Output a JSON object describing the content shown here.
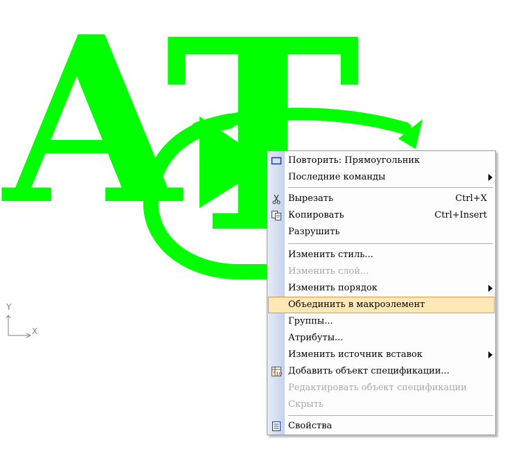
{
  "canvas": {
    "letter_a": "A",
    "letter_t": "T",
    "axis_y_label": "Y",
    "axis_x_label": "X",
    "drawing_color": "#00ff00"
  },
  "context_menu": {
    "items": [
      {
        "label": "Повторить: Прямоугольник",
        "shortcut": "",
        "submenu": false,
        "disabled": false,
        "icon": "rectangle-icon"
      },
      {
        "label": "Последние команды",
        "shortcut": "",
        "submenu": true,
        "disabled": false,
        "icon": ""
      },
      {
        "label": "Вырезать",
        "shortcut": "Ctrl+X",
        "submenu": false,
        "disabled": false,
        "icon": "scissors-icon"
      },
      {
        "label": "Копировать",
        "shortcut": "Ctrl+Insert",
        "submenu": false,
        "disabled": false,
        "icon": "copy-icon"
      },
      {
        "label": "Разрушить",
        "shortcut": "",
        "submenu": false,
        "disabled": false,
        "icon": ""
      },
      {
        "label": "Изменить стиль...",
        "shortcut": "",
        "submenu": false,
        "disabled": false,
        "icon": ""
      },
      {
        "label": "Изменить слой...",
        "shortcut": "",
        "submenu": false,
        "disabled": true,
        "icon": ""
      },
      {
        "label": "Изменить порядок",
        "shortcut": "",
        "submenu": true,
        "disabled": false,
        "icon": ""
      },
      {
        "label": "Объединить в макроэлемент",
        "shortcut": "",
        "submenu": false,
        "disabled": false,
        "highlighted": true,
        "icon": ""
      },
      {
        "label": "Группы...",
        "shortcut": "",
        "submenu": false,
        "disabled": false,
        "icon": ""
      },
      {
        "label": "Атрибуты...",
        "shortcut": "",
        "submenu": false,
        "disabled": false,
        "icon": ""
      },
      {
        "label": "Изменить источник вставок",
        "shortcut": "",
        "submenu": true,
        "disabled": false,
        "icon": ""
      },
      {
        "label": "Добавить объект спецификации...",
        "shortcut": "",
        "submenu": false,
        "disabled": false,
        "icon": "spec-table-add-icon"
      },
      {
        "label": "Редактировать объект спецификации",
        "shortcut": "",
        "submenu": false,
        "disabled": true,
        "icon": ""
      },
      {
        "label": "Скрыть",
        "shortcut": "",
        "submenu": false,
        "disabled": true,
        "icon": ""
      },
      {
        "label": "Свойства",
        "shortcut": "",
        "submenu": false,
        "disabled": false,
        "icon": "properties-icon"
      }
    ],
    "colors": {
      "highlight_fill": "#ffe8b5",
      "highlight_border": "#d69a4a",
      "disabled_text": "#a7a7a7"
    }
  }
}
